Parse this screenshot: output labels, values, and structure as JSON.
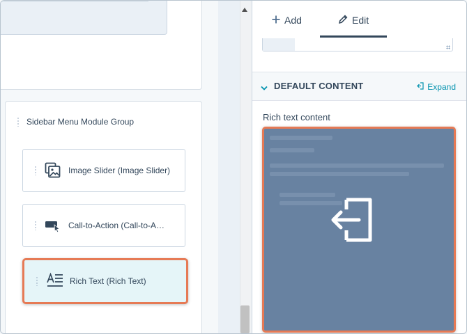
{
  "canvas": {
    "group": {
      "title": "Sidebar Menu Module Group",
      "modules": [
        {
          "label": "Image Slider (Image Slider)",
          "icon": "image-slider-icon",
          "selected": false
        },
        {
          "label": "Call-to-Action (Call-to-A…",
          "icon": "cta-icon",
          "selected": false
        },
        {
          "label": "Rich Text (Rich Text)",
          "icon": "rich-text-icon",
          "selected": true
        }
      ]
    }
  },
  "panel": {
    "tabs": [
      {
        "label": "Add",
        "icon": "plus-icon",
        "active": false
      },
      {
        "label": "Edit",
        "icon": "pencil-icon",
        "active": true
      }
    ],
    "section": {
      "title": "DEFAULT CONTENT",
      "expand_label": "Expand",
      "icon": "chevron-down-icon"
    },
    "field_label": "Rich text content",
    "drop_icon": "drop-enter-icon"
  },
  "colors": {
    "accent": "#e67a55",
    "link": "#0091ae",
    "text": "#33475b",
    "selected_bg": "#e5f5f8",
    "drop_overlay": "#6882a1"
  }
}
